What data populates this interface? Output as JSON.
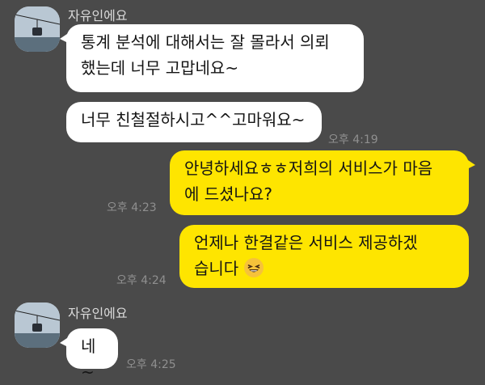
{
  "chat": {
    "messages": [
      {
        "sender": "자유인에요",
        "lines": [
          "통계 분석에 대해서는 잘 몰라서 의뢰",
          "했는데 너무 고맙네요~"
        ]
      },
      {
        "lines": [
          "너무 친철절하시고^^고마워요~"
        ],
        "time": "오후 4:19"
      },
      {
        "lines": [
          "안녕하세요ㅎㅎ저희의 서비스가 마음",
          "에 드셨나요?"
        ],
        "time": "오후 4:23"
      },
      {
        "lines": [
          "언제나 한결같은 서비스 제공하겠",
          "습니다"
        ],
        "emoji": "grinning-squinting-face",
        "time": "오후 4:24"
      },
      {
        "sender": "자유인에요",
        "lines": [
          "네~"
        ],
        "time": "오후 4:25"
      }
    ]
  },
  "colors": {
    "background": "#4a4a4a",
    "incoming_bubble": "#ffffff",
    "outgoing_bubble": "#fee500",
    "timestamp": "#8f8f8f"
  }
}
